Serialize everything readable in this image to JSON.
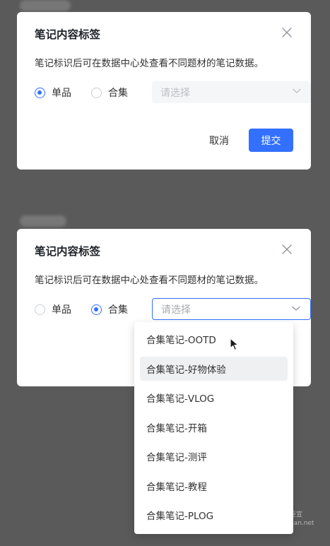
{
  "dialog": {
    "title": "笔记内容标签",
    "description": "笔记标识后可在数据中心处查看不同题材的笔记数据。",
    "radio_single": "单品",
    "radio_collection": "合集",
    "select_placeholder": "请选择",
    "cancel_label": "取消",
    "submit_label": "提交"
  },
  "state1": {
    "selected": "单品",
    "select_enabled": false
  },
  "state2": {
    "selected": "合集",
    "select_enabled": true,
    "dropdown_open": true,
    "hovered_option": "合集笔记-好物体验"
  },
  "dropdown": {
    "options": [
      "合集笔记-OOTD",
      "合集笔记-好物体验",
      "合集笔记-VLOG",
      "合集笔记-开箱",
      "合集笔记-测评",
      "合集笔记-教程",
      "合集笔记-PLOG"
    ]
  },
  "watermark": {
    "line1": "巨宣",
    "line2": "uan.net"
  },
  "colors": {
    "primary": "#3370ff",
    "overlay": "#5a5a5a",
    "hover_bg": "#eff0f1"
  },
  "icons": {
    "close": "close-icon",
    "arrow": "chevron-down-icon",
    "cursor": "mouse-pointer-icon"
  }
}
